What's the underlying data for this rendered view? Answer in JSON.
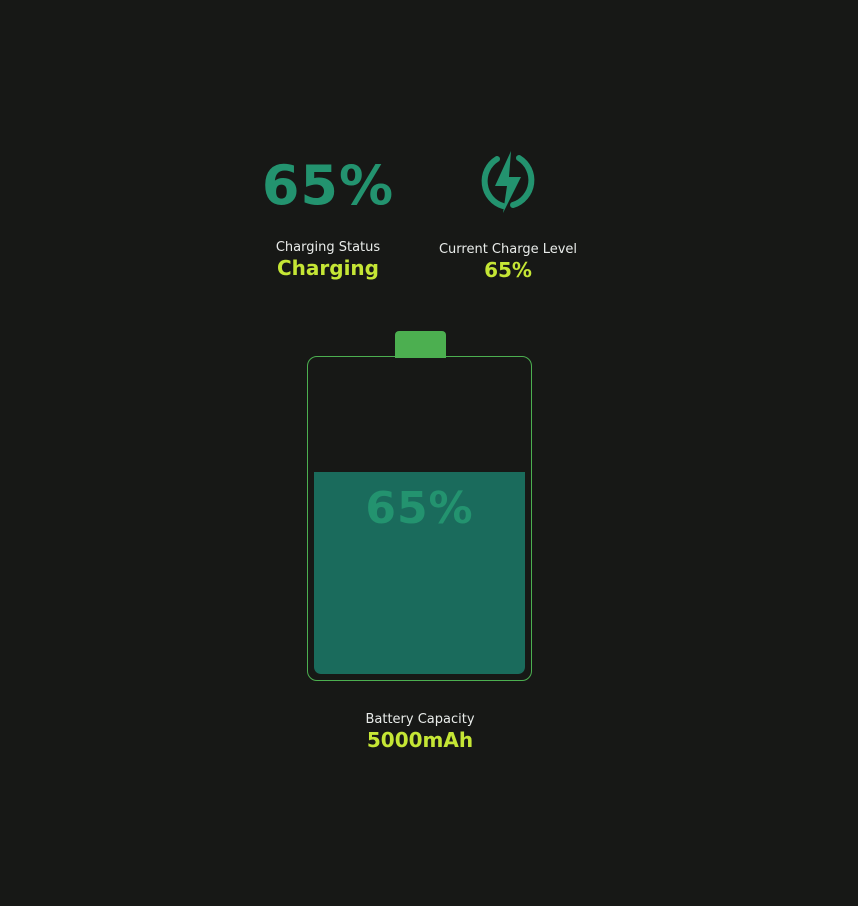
{
  "header": {
    "percent_text": "65%",
    "icon": "lightning-bolt-icon"
  },
  "charging_status": {
    "label": "Charging Status",
    "value": "Charging"
  },
  "charge_level": {
    "label": "Current Charge Level",
    "value": "65%"
  },
  "battery": {
    "level_fraction": 0.65,
    "label": "65%"
  },
  "capacity": {
    "label": "Battery Capacity",
    "value": "5000mAh"
  },
  "colors": {
    "background": "#171816",
    "accent_teal": "#23936f",
    "fill_teal": "#1a6b5c",
    "outline_green": "#4caf50",
    "value_lime": "#c5e635",
    "label_text": "#e9ecea"
  }
}
